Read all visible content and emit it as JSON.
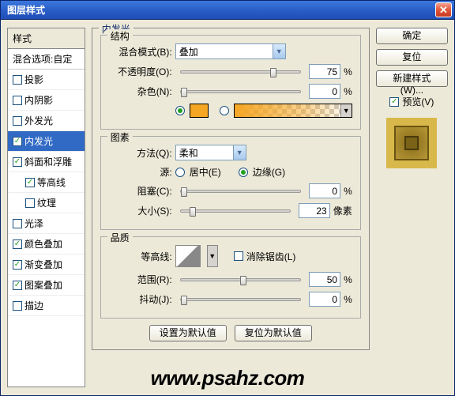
{
  "window": {
    "title": "图层样式"
  },
  "left": {
    "header": "样式",
    "blend": "混合选项:自定",
    "items": [
      {
        "label": "投影",
        "checked": false,
        "indent": false
      },
      {
        "label": "内阴影",
        "checked": false,
        "indent": false
      },
      {
        "label": "外发光",
        "checked": false,
        "indent": false
      },
      {
        "label": "内发光",
        "checked": true,
        "indent": false,
        "selected": true
      },
      {
        "label": "斜面和浮雕",
        "checked": true,
        "indent": false
      },
      {
        "label": "等高线",
        "checked": true,
        "indent": true
      },
      {
        "label": "纹理",
        "checked": false,
        "indent": true
      },
      {
        "label": "光泽",
        "checked": false,
        "indent": false
      },
      {
        "label": "颜色叠加",
        "checked": true,
        "indent": false
      },
      {
        "label": "渐变叠加",
        "checked": true,
        "indent": false
      },
      {
        "label": "图案叠加",
        "checked": true,
        "indent": false
      },
      {
        "label": "描边",
        "checked": false,
        "indent": false
      }
    ]
  },
  "main": {
    "title": "内发光",
    "structure": {
      "legend": "结构",
      "blendMode": {
        "label": "混合模式(B):",
        "value": "叠加"
      },
      "opacity": {
        "label": "不透明度(O):",
        "value": "75",
        "unit": "%",
        "pos": 75
      },
      "noise": {
        "label": "杂色(N):",
        "value": "0",
        "unit": "%",
        "pos": 0
      },
      "swatchColor": "#f5a623"
    },
    "elements": {
      "legend": "图素",
      "technique": {
        "label": "方法(Q):",
        "value": "柔和"
      },
      "sourceLabel": "源:",
      "center": "居中(E)",
      "edge": "边缘(G)",
      "edgeSelected": true,
      "choke": {
        "label": "阻塞(C):",
        "value": "0",
        "unit": "%",
        "pos": 0
      },
      "size": {
        "label": "大小(S):",
        "value": "23",
        "unit": "像素",
        "pos": 8
      }
    },
    "quality": {
      "legend": "品质",
      "contourLabel": "等高线:",
      "antiAlias": "消除锯齿(L)",
      "range": {
        "label": "范围(R):",
        "value": "50",
        "unit": "%",
        "pos": 50
      },
      "jitter": {
        "label": "抖动(J):",
        "value": "0",
        "unit": "%",
        "pos": 0
      }
    },
    "defaults": {
      "set": "设置为默认值",
      "reset": "复位为默认值"
    }
  },
  "right": {
    "ok": "确定",
    "cancel": "复位",
    "newStyle": "新建样式(W)...",
    "preview": "预览(V)"
  },
  "watermark": "www.psahz.com"
}
